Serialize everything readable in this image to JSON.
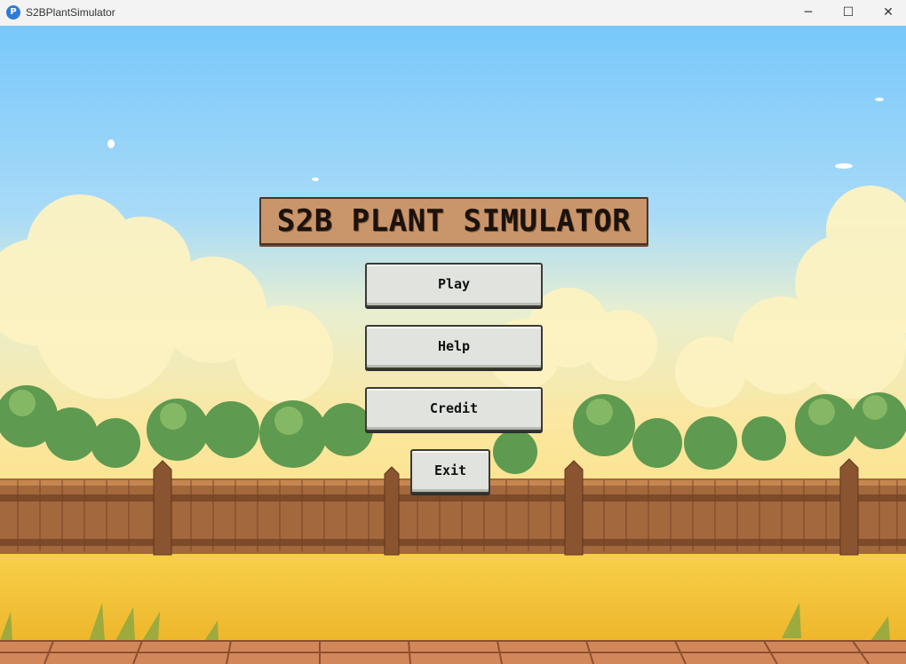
{
  "window": {
    "title": "S2BPlantSimulator",
    "app_icon_glyph": "P",
    "controls": {
      "minimize": "─",
      "maximize": "☐",
      "close": "✕"
    }
  },
  "game": {
    "title": "S2B PLANT SIMULATOR",
    "menu": {
      "play": "Play",
      "help": "Help",
      "credit": "Credit",
      "exit": "Exit"
    }
  },
  "colors": {
    "sky_top": "#78c8fb",
    "sky_bottom": "#fbe7a0",
    "banner": "#c9956a",
    "button": "#e1e4de",
    "grass": "#f3c43a",
    "fence": "#a4683d"
  }
}
